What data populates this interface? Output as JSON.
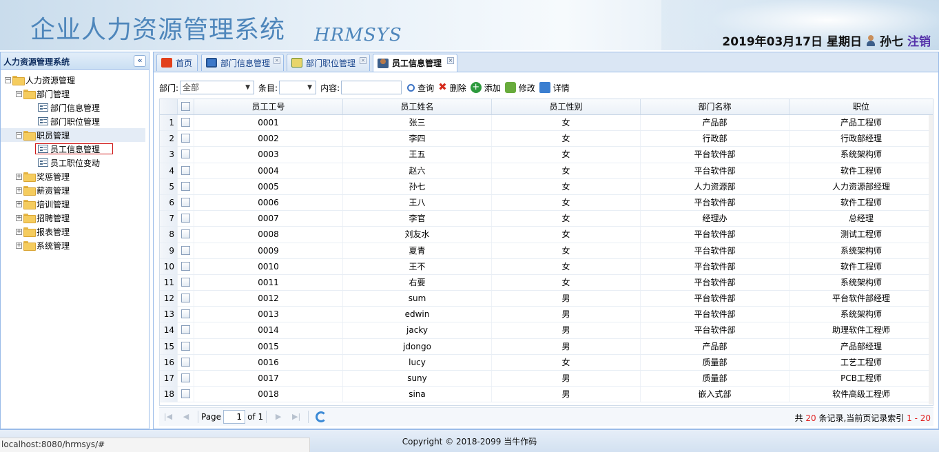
{
  "header": {
    "title": "企业人力资源管理系统",
    "subtitle": "HRMSYS",
    "date": "2019年03月17日",
    "weekday": "星期日",
    "user": "孙七",
    "logout": "注销"
  },
  "sidebar": {
    "title": "人力资源管理系统",
    "collapse_glyph": "«",
    "tree": [
      {
        "label": "人力资源管理",
        "toggle": "−",
        "type": "folder"
      },
      {
        "label": "部门管理",
        "toggle": "−",
        "type": "folder"
      },
      {
        "label": "部门信息管理",
        "type": "file"
      },
      {
        "label": "部门职位管理",
        "type": "file"
      },
      {
        "label": "职员管理",
        "toggle": "−",
        "type": "folder"
      },
      {
        "label": "员工信息管理",
        "type": "file"
      },
      {
        "label": "员工职位变动",
        "type": "file"
      },
      {
        "label": "奖惩管理",
        "toggle": "+",
        "type": "folder"
      },
      {
        "label": "薪资管理",
        "toggle": "+",
        "type": "folder"
      },
      {
        "label": "培训管理",
        "toggle": "+",
        "type": "folder"
      },
      {
        "label": "招聘管理",
        "toggle": "+",
        "type": "folder"
      },
      {
        "label": "报表管理",
        "toggle": "+",
        "type": "folder"
      },
      {
        "label": "系统管理",
        "toggle": "+",
        "type": "folder"
      }
    ]
  },
  "tabs": [
    {
      "label": "首页",
      "icon": "home-icon"
    },
    {
      "label": "部门信息管理",
      "icon": "monitor-icon",
      "close": "×"
    },
    {
      "label": "部门职位管理",
      "icon": "grid-icon",
      "close": "×"
    },
    {
      "label": "员工信息管理",
      "icon": "user-icon",
      "close": "×",
      "active": true
    }
  ],
  "toolbar": {
    "dept_label": "部门:",
    "dept_value": "全部",
    "item_label": "条目:",
    "item_value": "",
    "content_label": "内容:",
    "content_value": "",
    "query": "查询",
    "delete": "删除",
    "add": "添加",
    "edit": "修改",
    "detail": "详情"
  },
  "table": {
    "columns": [
      "员工工号",
      "员工姓名",
      "员工性别",
      "部门名称",
      "职位"
    ],
    "rows": [
      [
        "1",
        "0001",
        "张三",
        "女",
        "产品部",
        "产品工程师"
      ],
      [
        "2",
        "0002",
        "李四",
        "女",
        "行政部",
        "行政部经理"
      ],
      [
        "3",
        "0003",
        "王五",
        "女",
        "平台软件部",
        "系统架构师"
      ],
      [
        "4",
        "0004",
        "赵六",
        "女",
        "平台软件部",
        "软件工程师"
      ],
      [
        "5",
        "0005",
        "孙七",
        "女",
        "人力资源部",
        "人力资源部经理"
      ],
      [
        "6",
        "0006",
        "王八",
        "女",
        "平台软件部",
        "软件工程师"
      ],
      [
        "7",
        "0007",
        "李官",
        "女",
        "经理办",
        "总经理"
      ],
      [
        "8",
        "0008",
        "刘友水",
        "女",
        "平台软件部",
        "测试工程师"
      ],
      [
        "9",
        "0009",
        "夏青",
        "女",
        "平台软件部",
        "系统架构师"
      ],
      [
        "10",
        "0010",
        "王不",
        "女",
        "平台软件部",
        "软件工程师"
      ],
      [
        "11",
        "0011",
        "右要",
        "女",
        "平台软件部",
        "系统架构师"
      ],
      [
        "12",
        "0012",
        "sum",
        "男",
        "平台软件部",
        "平台软件部经理"
      ],
      [
        "13",
        "0013",
        "edwin",
        "男",
        "平台软件部",
        "系统架构师"
      ],
      [
        "14",
        "0014",
        "jacky",
        "男",
        "平台软件部",
        "助理软件工程师"
      ],
      [
        "15",
        "0015",
        "jdongo",
        "男",
        "产品部",
        "产品部经理"
      ],
      [
        "16",
        "0016",
        "lucy",
        "女",
        "质量部",
        "工艺工程师"
      ],
      [
        "17",
        "0017",
        "suny",
        "男",
        "质量部",
        "PCB工程师"
      ],
      [
        "18",
        "0018",
        "sina",
        "男",
        "嵌入式部",
        "软件高级工程师"
      ]
    ]
  },
  "pager": {
    "page_label": "Page",
    "page_value": "1",
    "of_label": "of 1",
    "info_prefix": "共",
    "total": "20",
    "info_mid": "条记录,当前页记录索引",
    "range": "1 - 20"
  },
  "footer": {
    "copyright": "Copyright © 2018-2099 当牛作码",
    "status_url": "localhost:8080/hrmsys/#"
  }
}
